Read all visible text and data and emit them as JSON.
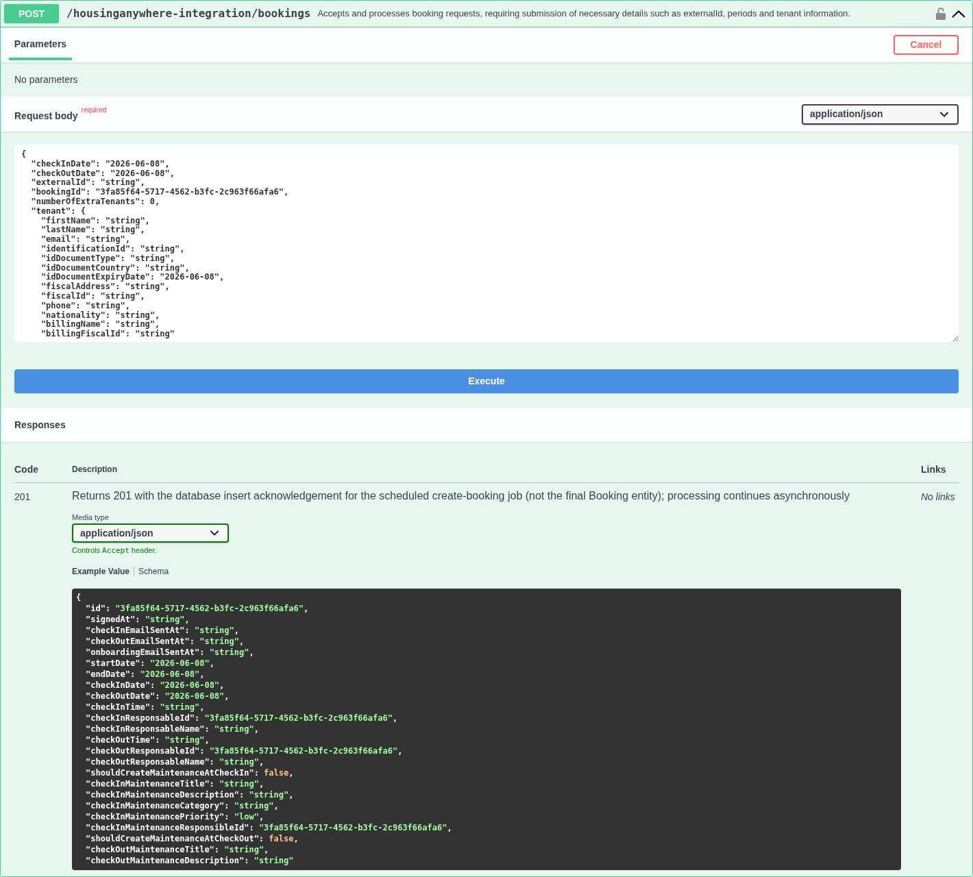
{
  "operation": {
    "method": "POST",
    "path": "/housinganywhere-integration/bookings",
    "summary": "Accepts and processes booking requests, requiring submission of necessary details such as externalId, periods and tenant information.",
    "locked": false,
    "expanded": true
  },
  "tabs": [
    {
      "label": "Parameters",
      "selected": true
    }
  ],
  "cancel_button": {
    "label": "Cancel"
  },
  "parameters": {
    "message": "No parameters"
  },
  "request_body": {
    "title": "Request body",
    "required_label": "required",
    "content_type": "application/json",
    "value": "{\n  \"checkInDate\": \"2026-06-08\",\n  \"checkOutDate\": \"2026-06-08\",\n  \"externalId\": \"string\",\n  \"bookingId\": \"3fa85f64-5717-4562-b3fc-2c963f66afa6\",\n  \"numberOfExtraTenants\": 0,\n  \"tenant\": {\n    \"firstName\": \"string\",\n    \"lastName\": \"string\",\n    \"email\": \"string\",\n    \"identificationId\": \"string\",\n    \"idDocumentType\": \"string\",\n    \"idDocumentCountry\": \"string\",\n    \"idDocumentExpiryDate\": \"2026-06-08\",\n    \"fiscalAddress\": \"string\",\n    \"fiscalId\": \"string\",\n    \"phone\": \"string\",\n    \"nationality\": \"string\",\n    \"billingName\": \"string\",\n    \"billingFiscalId\": \"string\""
  },
  "execute_button": {
    "label": "Execute"
  },
  "responses": {
    "title": "Responses",
    "columns": [
      {
        "label": "Code",
        "kind": "code"
      },
      {
        "label": "Description",
        "kind": "description"
      },
      {
        "label": "Links",
        "kind": "links"
      }
    ],
    "rows": [
      {
        "code": "201",
        "description": "Returns 201 with the database insert acknowledgement for the scheduled create-booking job (not the final Booking entity); processing continues asynchronously",
        "links": "No links",
        "media_type_label": "Media type",
        "media_type": "application/json",
        "hint": {
          "before": "Controls",
          "code": "Accept",
          "after": "header."
        },
        "example_tabs": [
          {
            "label": "Example Value",
            "selected": true
          },
          {
            "label": "Schema",
            "selected": false
          }
        ],
        "example": {
          "open": "{",
          "members": [
            {
              "key": "\"id\":",
              "value": "\"3fa85f64-5717-4562-b3fc-2c963f66afa6\"",
              "kind": "string",
              "end": ","
            },
            {
              "key": "\"signedAt\":",
              "value": "\"string\"",
              "kind": "string",
              "end": ","
            },
            {
              "key": "\"checkInEmailSentAt\":",
              "value": "\"string\"",
              "kind": "string",
              "end": ","
            },
            {
              "key": "\"checkOutEmailSentAt\":",
              "value": "\"string\"",
              "kind": "string",
              "end": ","
            },
            {
              "key": "\"onboardingEmailSentAt\":",
              "value": "\"string\"",
              "kind": "string",
              "end": ","
            },
            {
              "key": "\"startDate\":",
              "value": "\"2026-06-08\"",
              "kind": "string",
              "end": ","
            },
            {
              "key": "\"endDate\":",
              "value": "\"2026-06-08\"",
              "kind": "string",
              "end": ","
            },
            {
              "key": "\"checkInDate\":",
              "value": "\"2026-06-08\"",
              "kind": "string",
              "end": ","
            },
            {
              "key": "\"checkOutDate\":",
              "value": "\"2026-06-08\"",
              "kind": "string",
              "end": ","
            },
            {
              "key": "\"checkInTime\":",
              "value": "\"string\"",
              "kind": "string",
              "end": ","
            },
            {
              "key": "\"checkInResponsableId\":",
              "value": "\"3fa85f64-5717-4562-b3fc-2c963f66afa6\"",
              "kind": "string",
              "end": ","
            },
            {
              "key": "\"checkInResponsableName\":",
              "value": "\"string\"",
              "kind": "string",
              "end": ","
            },
            {
              "key": "\"checkOutTime\":",
              "value": "\"string\"",
              "kind": "string",
              "end": ","
            },
            {
              "key": "\"checkOutResponsableId\":",
              "value": "\"3fa85f64-5717-4562-b3fc-2c963f66afa6\"",
              "kind": "string",
              "end": ","
            },
            {
              "key": "\"checkOutResponsableName\":",
              "value": "\"string\"",
              "kind": "string",
              "end": ","
            },
            {
              "key": "\"shouldCreateMaintenanceAtCheckIn\":",
              "value": "false",
              "kind": "boolean",
              "end": ","
            },
            {
              "key": "\"checkInMaintenanceTitle\":",
              "value": "\"string\"",
              "kind": "string",
              "end": ","
            },
            {
              "key": "\"checkInMaintenanceDescription\":",
              "value": "\"string\"",
              "kind": "string",
              "end": ","
            },
            {
              "key": "\"checkInMaintenanceCategory\":",
              "value": "\"string\"",
              "kind": "string",
              "end": ","
            },
            {
              "key": "\"checkInMaintenancePriority\":",
              "value": "\"low\"",
              "kind": "string",
              "end": ","
            },
            {
              "key": "\"checkInMaintenanceResponsibleId\":",
              "value": "\"3fa85f64-5717-4562-b3fc-2c963f66afa6\"",
              "kind": "string",
              "end": ","
            },
            {
              "key": "\"shouldCreateMaintenanceAtCheckOut\":",
              "value": "false",
              "kind": "boolean",
              "end": ","
            },
            {
              "key": "\"checkOutMaintenanceTitle\":",
              "value": "\"string\"",
              "kind": "string",
              "end": ","
            },
            {
              "key": "\"checkOutMaintenanceDescription\":",
              "value": "\"string\"",
              "kind": "string"
            }
          ]
        }
      }
    ]
  }
}
